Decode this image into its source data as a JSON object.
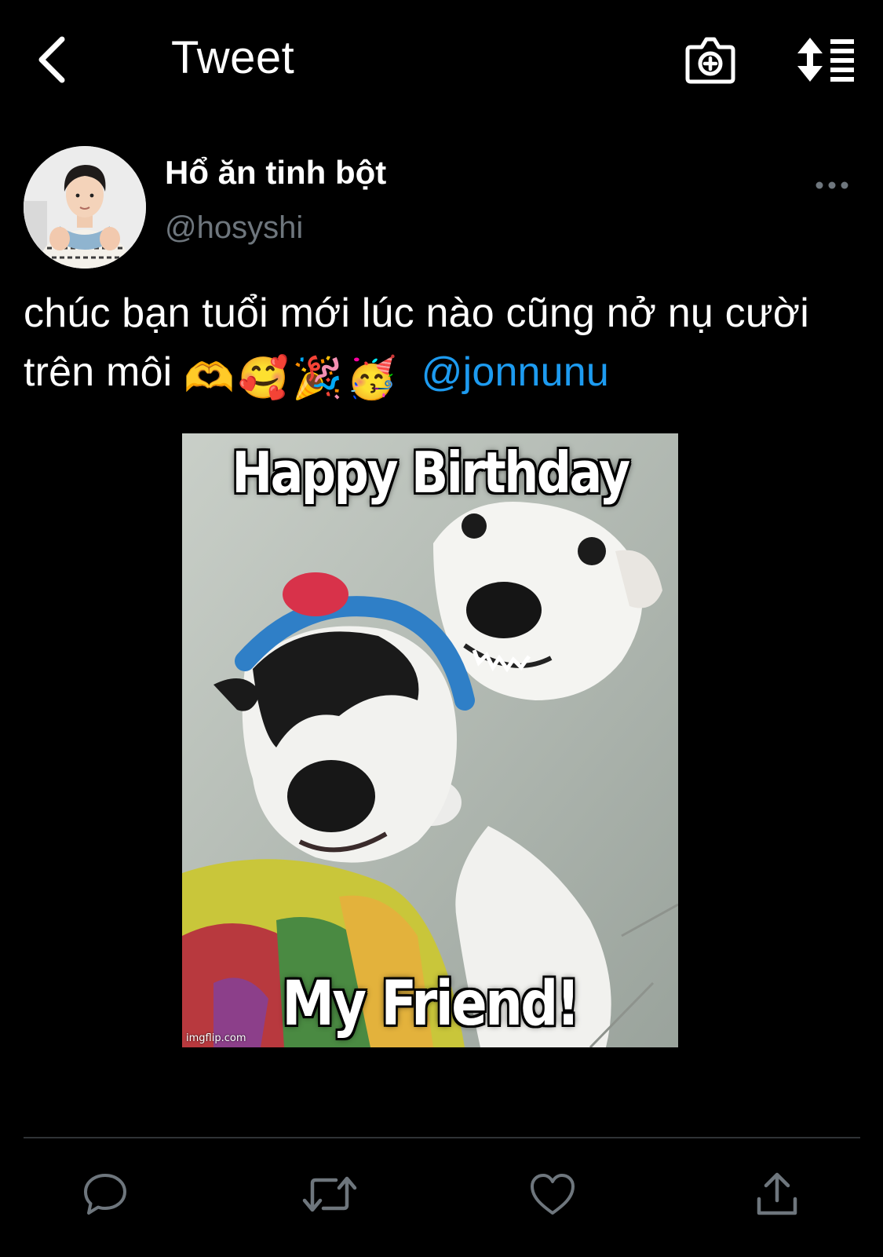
{
  "header": {
    "title": "Tweet",
    "back_icon": "chevron-left-icon",
    "camera_icon": "camera-plus-icon",
    "sort_icon": "sort-list-icon"
  },
  "tweet": {
    "author": {
      "display_name": "Hổ ăn tinh bột",
      "handle": "@hosyshi"
    },
    "text_line1": "chúc bạn tuổi mới lúc nào cũng nở nụ cười",
    "text_line2_prefix": "trên môi",
    "emojis": [
      "🫶",
      "🥰",
      "🎉",
      "🥳"
    ],
    "mention": "@jonnunu",
    "media": {
      "top_caption": "Happy Birthday",
      "bottom_caption": "My Friend!",
      "watermark": "imgflip.com"
    }
  },
  "actions": [
    "reply-icon",
    "retweet-icon",
    "like-icon",
    "share-icon"
  ],
  "colors": {
    "background": "#000000",
    "text": "#ffffff",
    "secondary_text": "#6e767d",
    "link": "#1d9bf0",
    "divider": "#2f3336"
  }
}
